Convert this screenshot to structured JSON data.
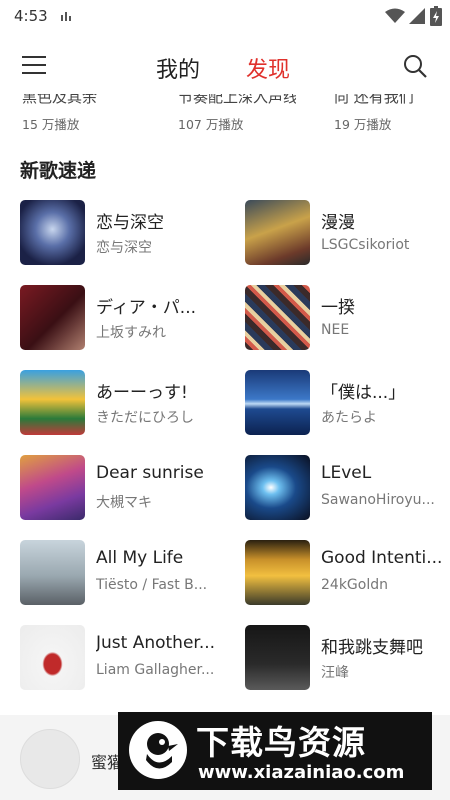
{
  "status_bar": {
    "time": "4:53"
  },
  "nav": {
    "tab_mine": "我的",
    "tab_discover": "发现",
    "active_tab": "发现"
  },
  "playlists": [
    {
      "title": "黑色及其余",
      "play_count": "15 万播放"
    },
    {
      "title": "节奏配上深入声线",
      "play_count": "107 万播放"
    },
    {
      "title": "向 还有我们",
      "play_count": "19 万播放"
    }
  ],
  "new_songs": {
    "section_title": "新歌速递",
    "items": [
      {
        "title": "恋与深空",
        "artist": "恋与深空"
      },
      {
        "title": "漫漫",
        "artist": "LSGCsikoriot"
      },
      {
        "title": "ディア・パ...",
        "artist": "上坂すみれ"
      },
      {
        "title": "一揆",
        "artist": "NEE"
      },
      {
        "title": "あーーっす!",
        "artist": "きただにひろし"
      },
      {
        "title": "「僕は...」",
        "artist": "あたらよ"
      },
      {
        "title": "Dear sunrise",
        "artist": "大槻マキ"
      },
      {
        "title": "LEveL",
        "artist": "SawanoHiroyu..."
      },
      {
        "title": "All My Life",
        "artist": "Tiësto / Fast B..."
      },
      {
        "title": "Good Intenti...",
        "artist": "24kGoldn"
      },
      {
        "title": "Just Another...",
        "artist": "Liam Gallagher..."
      },
      {
        "title": "和我跳支舞吧",
        "artist": "汪峰"
      }
    ]
  },
  "player": {
    "title": "蜜獾"
  },
  "watermark": {
    "title": "下载鸟资源",
    "url": "www.xiazainiao.com"
  },
  "colors": {
    "accent": "#e0312c"
  }
}
